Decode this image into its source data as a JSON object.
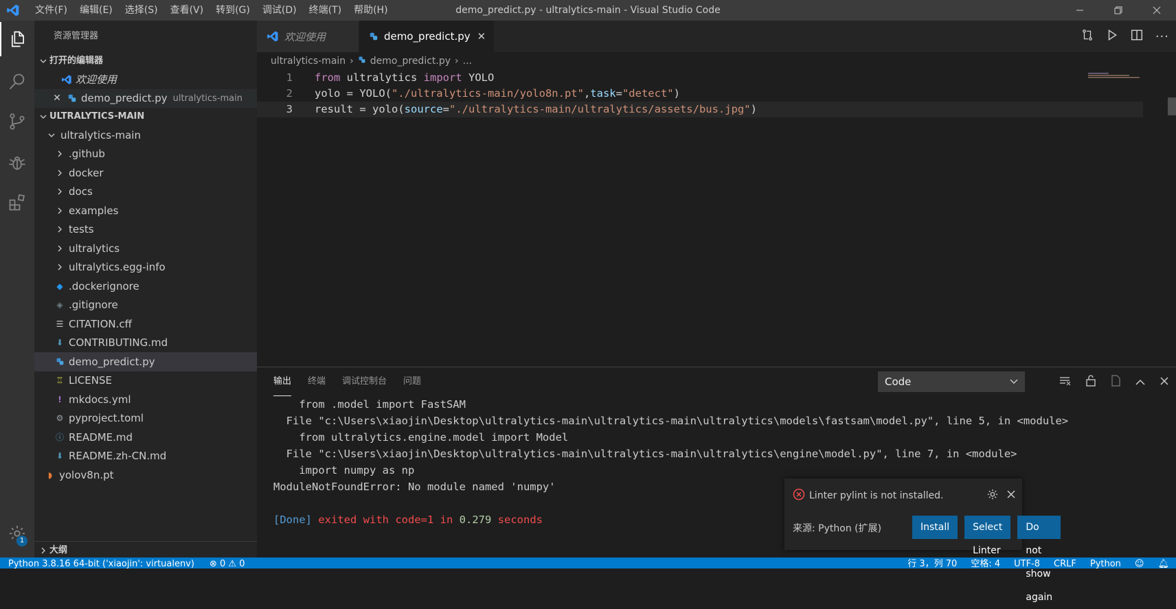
{
  "titlebar": {
    "menus": [
      "文件(F)",
      "编辑(E)",
      "选择(S)",
      "查看(V)",
      "转到(G)",
      "调试(D)",
      "终端(T)",
      "帮助(H)"
    ],
    "title": "demo_predict.py - ultralytics-main - Visual Studio Code"
  },
  "activity": {
    "badge": "1"
  },
  "sidebar": {
    "header": "资源管理器",
    "open_editors_title": "打开的编辑器",
    "open_editors": [
      {
        "label": "欢迎使用",
        "desc": ""
      },
      {
        "label": "demo_predict.py",
        "desc": "ultralytics-main"
      }
    ],
    "root_title": "ULTRALYTICS-MAIN",
    "folder": "ultralytics-main",
    "items": [
      {
        "label": ".github",
        "type": "folder"
      },
      {
        "label": "docker",
        "type": "folder"
      },
      {
        "label": "docs",
        "type": "folder"
      },
      {
        "label": "examples",
        "type": "folder"
      },
      {
        "label": "tests",
        "type": "folder"
      },
      {
        "label": "ultralytics",
        "type": "folder"
      },
      {
        "label": "ultralytics.egg-info",
        "type": "folder"
      },
      {
        "label": ".dockerignore",
        "type": "docker"
      },
      {
        "label": ".gitignore",
        "type": "git"
      },
      {
        "label": "CITATION.cff",
        "type": "text"
      },
      {
        "label": "CONTRIBUTING.md",
        "type": "md"
      },
      {
        "label": "demo_predict.py",
        "type": "py"
      },
      {
        "label": "LICENSE",
        "type": "license"
      },
      {
        "label": "mkdocs.yml",
        "type": "yml"
      },
      {
        "label": "pyproject.toml",
        "type": "toml"
      },
      {
        "label": "README.md",
        "type": "info"
      },
      {
        "label": "README.zh-CN.md",
        "type": "md"
      }
    ],
    "root_file": "yolov8n.pt",
    "outline_title": "大纲"
  },
  "tabs": [
    {
      "label": "欢迎使用"
    },
    {
      "label": "demo_predict.py"
    }
  ],
  "breadcrumb": [
    "ultralytics-main",
    "demo_predict.py",
    "..."
  ],
  "code": {
    "line1": {
      "n": "1",
      "kw1": "from",
      "t1": " ultralytics ",
      "kw2": "import",
      "t2": " YOLO"
    },
    "line2": {
      "n": "2",
      "t1": "yolo = YOLO(",
      "s1": "\"./ultralytics-main/yolo8n.pt\"",
      "t2": ",",
      "p1": "task",
      "t3": "=",
      "s2": "\"detect\"",
      "t4": ")"
    },
    "line3": {
      "n": "3",
      "t1": "result = yolo(",
      "p1": "source",
      "t2": "=",
      "s1": "\"./ultralytics-main/ultralytics/assets/bus.jpg\"",
      "t3": ")"
    }
  },
  "panel": {
    "tabs": [
      "输出",
      "终端",
      "调试控制台",
      "问题"
    ],
    "select": "Code",
    "output": [
      "    from .model import FastSAM",
      "  File \"c:\\Users\\xiaojin\\Desktop\\ultralytics-main\\ultralytics-main\\ultralytics\\models\\fastsam\\model.py\", line 5, in <module>",
      "    from ultralytics.engine.model import Model",
      "  File \"c:\\Users\\xiaojin\\Desktop\\ultralytics-main\\ultralytics-main\\ultralytics\\engine\\model.py\", line 7, in <module>",
      "    import numpy as np",
      "ModuleNotFoundError: No module named 'numpy'"
    ],
    "done": {
      "tag": "[Done]",
      "a": " exited with ",
      "b": "code=1",
      "c": " in ",
      "d": "0.279",
      "e": " seconds"
    }
  },
  "notification": {
    "message": "Linter pylint is not installed.",
    "source": "来源: Python (扩展)",
    "buttons": [
      "Install",
      "Select Linter",
      "Do not show again"
    ]
  },
  "statusbar": {
    "left": [
      "Python 3.8.16 64-bit ('xiaojin': virtualenv)",
      "⊗ 0  ⚠ 0"
    ],
    "right": [
      "行 3，列 70",
      "空格: 4",
      "UTF-8",
      "CRLF",
      "Python"
    ]
  },
  "colors": {
    "accent": "#007acc",
    "button": "#0e639c",
    "error": "#f14c4c"
  }
}
